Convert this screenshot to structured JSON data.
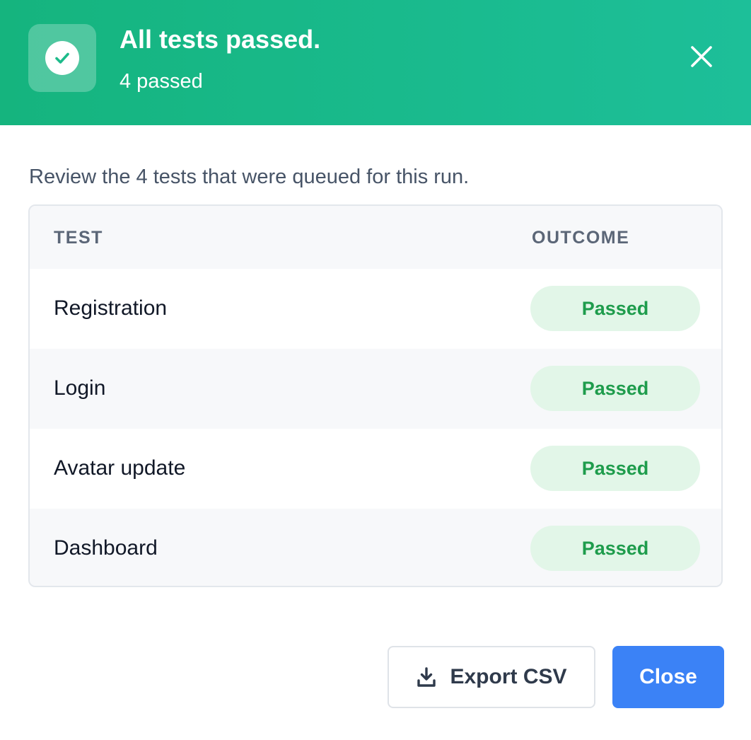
{
  "header": {
    "title": "All tests passed.",
    "subtitle": "4 passed",
    "icon": "check-circle-icon",
    "close_icon": "close-icon",
    "colors": {
      "gradient_start": "#15b47e",
      "gradient_end": "#1dbf99"
    }
  },
  "intro": "Review the 4 tests that were queued for this run.",
  "table": {
    "columns": [
      "TEST",
      "OUTCOME"
    ],
    "rows": [
      {
        "test": "Registration",
        "outcome": "Passed"
      },
      {
        "test": "Login",
        "outcome": "Passed"
      },
      {
        "test": "Avatar update",
        "outcome": "Passed"
      },
      {
        "test": "Dashboard",
        "outcome": "Passed"
      }
    ],
    "colors": {
      "passed_bg": "#e2f6e8",
      "passed_text": "#1e9c4c"
    }
  },
  "footer": {
    "export_label": "Export CSV",
    "export_icon": "download-icon",
    "close_label": "Close",
    "colors": {
      "primary": "#3b82f6"
    }
  }
}
